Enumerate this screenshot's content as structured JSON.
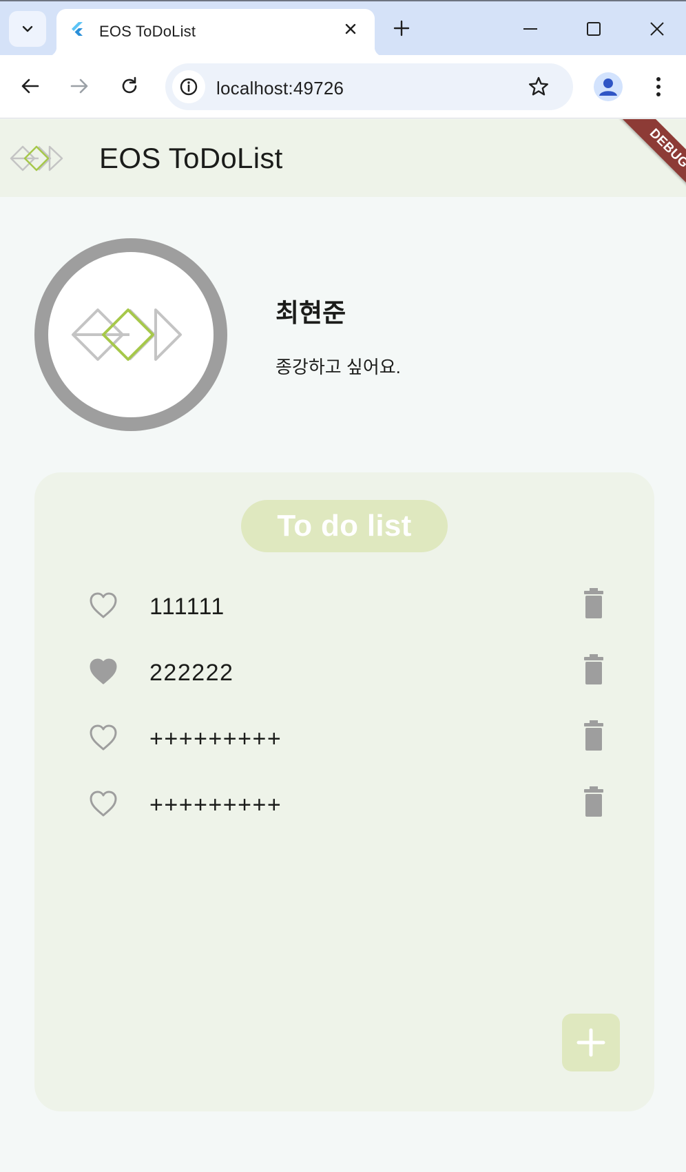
{
  "browser": {
    "tab_title": "EOS ToDoList",
    "url": "localhost:49726"
  },
  "appbar": {
    "title": "EOS ToDoList",
    "debug_banner": "DEBUG"
  },
  "profile": {
    "name": "최현준",
    "status": "종강하고 싶어요."
  },
  "todo": {
    "header": "To do list",
    "items": [
      {
        "text": "111111",
        "liked": false
      },
      {
        "text": "222222",
        "liked": true
      },
      {
        "text": "+++++++++",
        "liked": false
      },
      {
        "text": "+++++++++",
        "liked": false
      }
    ]
  },
  "colors": {
    "appbar_bg": "#eef3e9",
    "page_bg": "#f4f8f7",
    "accent_green": "#a6c84a",
    "logo_gray": "#c4c4c4",
    "pill_bg": "#dfe8bf",
    "icon_gray": "#9e9e9e",
    "debug_red": "#8d3b36"
  }
}
